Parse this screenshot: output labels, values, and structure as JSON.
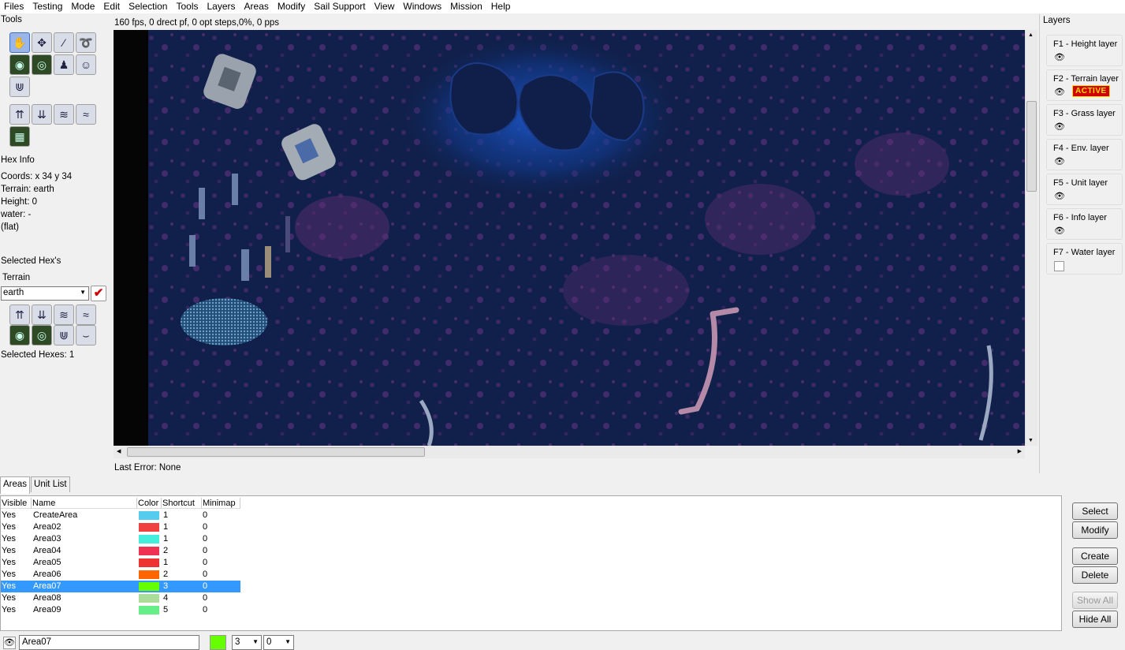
{
  "menu": [
    "Files",
    "Testing",
    "Mode",
    "Edit",
    "Selection",
    "Tools",
    "Layers",
    "Areas",
    "Modify",
    "Sail Support",
    "View",
    "Windows",
    "Mission",
    "Help"
  ],
  "left": {
    "tools_label": "Tools",
    "hex_info_label": "Hex Info",
    "coords": "Coords: x 34 y 34",
    "terrain": "Terrain: earth",
    "height": "Height: 0",
    "water": "water: -",
    "flat": "(flat)",
    "selected_hexes_label": "Selected Hex's",
    "terrain_label": "Terrain",
    "terrain_value": "earth",
    "selected_count": "Selected Hexes: 1"
  },
  "status": {
    "fps": "160 fps, 0 drect pf, 0 opt steps,0%, 0 pps",
    "last_error": "Last Error: None"
  },
  "layers": {
    "title": "Layers",
    "items": [
      {
        "label": "F1 - Height layer",
        "visible": true
      },
      {
        "label": "F2 - Terrain layer",
        "visible": true,
        "badge": "ACTIVE"
      },
      {
        "label": "F3 - Grass layer",
        "visible": true
      },
      {
        "label": "F4 - Env. layer",
        "visible": true
      },
      {
        "label": "F5 - Unit layer",
        "visible": true
      },
      {
        "label": "F6 - Info layer",
        "visible": true
      },
      {
        "label": "F7 - Water layer",
        "visible": false
      }
    ]
  },
  "tabs": [
    "Areas",
    "Unit List"
  ],
  "areas": {
    "headers": [
      "Visible",
      "Name",
      "Color",
      "Shortcut",
      "Minimap"
    ],
    "rows": [
      {
        "visible": "Yes",
        "name": "CreateArea",
        "color": "#55ccee",
        "shortcut": "1",
        "minimap": "0"
      },
      {
        "visible": "Yes",
        "name": "Area02",
        "color": "#f04040",
        "shortcut": "1",
        "minimap": "0"
      },
      {
        "visible": "Yes",
        "name": "Area03",
        "color": "#44eedd",
        "shortcut": "1",
        "minimap": "0"
      },
      {
        "visible": "Yes",
        "name": "Area04",
        "color": "#ee3355",
        "shortcut": "2",
        "minimap": "0"
      },
      {
        "visible": "Yes",
        "name": "Area05",
        "color": "#ee3333",
        "shortcut": "1",
        "minimap": "0"
      },
      {
        "visible": "Yes",
        "name": "Area06",
        "color": "#ff6600",
        "shortcut": "2",
        "minimap": "0"
      },
      {
        "visible": "Yes",
        "name": "Area07",
        "color": "#66ff00",
        "shortcut": "3",
        "minimap": "0",
        "selected": true
      },
      {
        "visible": "Yes",
        "name": "Area08",
        "color": "#aadd99",
        "shortcut": "4",
        "minimap": "0"
      },
      {
        "visible": "Yes",
        "name": "Area09",
        "color": "#66ee88",
        "shortcut": "5",
        "minimap": "0"
      }
    ]
  },
  "buttons": {
    "select": "Select",
    "modify": "Modify",
    "create": "Create",
    "delete": "Delete",
    "show_all": "Show All",
    "hide_all": "Hide All"
  },
  "bottom": {
    "name_value": "Area07",
    "color": "#66ff00",
    "shortcut": "3",
    "minimap": "0"
  }
}
